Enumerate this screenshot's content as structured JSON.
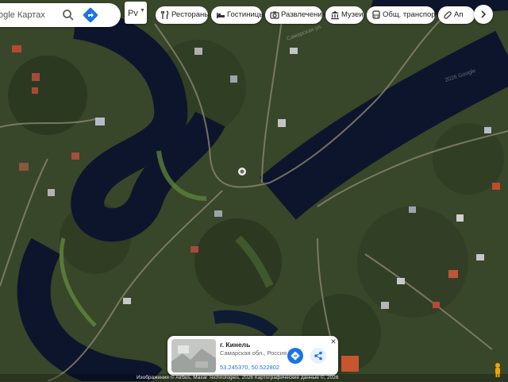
{
  "search": {
    "text": "ogle Картах"
  },
  "map_type": {
    "label": "Рv"
  },
  "chips": [
    {
      "label": "Рестораны",
      "icon": "fork-knife-icon"
    },
    {
      "label": "Гостиницы",
      "icon": "bed-icon"
    },
    {
      "label": "Развлечения",
      "icon": "camera-icon"
    },
    {
      "label": "Музеи",
      "icon": "museum-icon"
    },
    {
      "label": "Общ. транспорт",
      "icon": "bus-icon"
    },
    {
      "label": "Ап",
      "icon": "pill-icon"
    }
  ],
  "place_card": {
    "title": "г. Кинель",
    "region": "Самарская обл., Россия",
    "coordinates": "53.245370, 50.522802"
  },
  "footer": {
    "attribution": "Изображения © Airbus, Maxar Technologies, 2026 Картографические данные ©, 2026"
  },
  "map_labels": {
    "top": "Самарская ул.",
    "right": "2026 Google"
  },
  "colors": {
    "accent": "#1a73e8",
    "water": "#0e1630",
    "vegetation": "#2b3a1f"
  }
}
